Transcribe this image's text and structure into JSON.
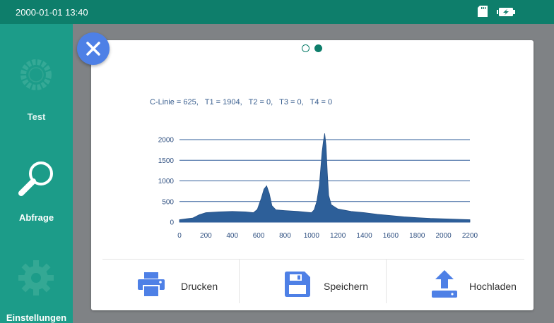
{
  "status_bar": {
    "datetime": "2000-01-01 13:40",
    "icons": [
      "sd-card-icon",
      "battery-charging-icon"
    ]
  },
  "sidebar": {
    "items": [
      {
        "label": "Test",
        "icon": "test-ring-icon",
        "active": false
      },
      {
        "label": "Abfrage",
        "icon": "magnifier-icon",
        "active": true
      },
      {
        "label": "Einstellungen",
        "icon": "gear-icon",
        "active": false
      }
    ]
  },
  "page_indicator": {
    "count": 2,
    "current": 2
  },
  "result": {
    "text": "C-Linie = 625,   T1 = 1904,   T2 = 0,   T3 = 0,   T4 = 0"
  },
  "actions": {
    "print_label": "Drucken",
    "save_label": "Speichern",
    "upload_label": "Hochladen"
  },
  "colors": {
    "status_bar": "#0e7e6b",
    "sidebar": "#1c9c89",
    "accent_blue": "#4e80e6",
    "chart_fill": "#2d5f99",
    "chart_text": "#2e4f80"
  },
  "chart_data": {
    "type": "area",
    "title": "",
    "xlabel": "",
    "ylabel": "",
    "xlim": [
      0,
      2200
    ],
    "ylim": [
      0,
      2000
    ],
    "x_ticks": [
      0,
      200,
      400,
      600,
      800,
      1000,
      1200,
      1400,
      1600,
      1800,
      2000,
      2200
    ],
    "y_ticks": [
      0,
      500,
      1000,
      1500,
      2000
    ],
    "grid": true,
    "x": [
      0,
      50,
      100,
      150,
      200,
      300,
      400,
      500,
      560,
      590,
      620,
      640,
      660,
      680,
      700,
      730,
      760,
      800,
      900,
      1000,
      1020,
      1040,
      1060,
      1070,
      1080,
      1090,
      1100,
      1110,
      1120,
      1130,
      1150,
      1200,
      1300,
      1400,
      1500,
      1600,
      1700,
      1800,
      1900,
      2000,
      2100,
      2200
    ],
    "values": [
      60,
      80,
      100,
      180,
      230,
      250,
      260,
      250,
      230,
      310,
      580,
      800,
      880,
      700,
      400,
      300,
      290,
      280,
      260,
      230,
      300,
      500,
      900,
      1300,
      1700,
      1950,
      2150,
      1850,
      1200,
      650,
      420,
      320,
      260,
      230,
      190,
      160,
      130,
      110,
      90,
      80,
      70,
      60
    ]
  }
}
